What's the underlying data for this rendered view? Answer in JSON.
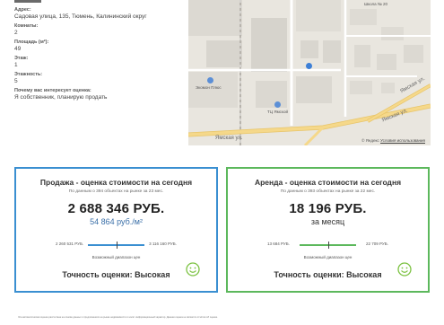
{
  "info": {
    "fields": [
      {
        "label": "Адрес:",
        "value": "Садовая улица, 135, Тюмень, Калининский округ"
      },
      {
        "label": "Комнаты:",
        "value": "2"
      },
      {
        "label": "Площадь (м²):",
        "value": "49"
      },
      {
        "label": "Этаж:",
        "value": "1"
      },
      {
        "label": "Этажность:",
        "value": "5"
      },
      {
        "label": "Почему вас интересует оценка:",
        "value": "Я собственник, планирую продать"
      }
    ]
  },
  "map": {
    "streets": [
      "Ямская ул.",
      "Ямская ул.",
      "Ямская ул."
    ],
    "pois": [
      "Экомон Плюс",
      "ТЦ Ямской",
      "Школа № 20"
    ],
    "copyright": "© Яндекс",
    "terms_link": "Условия использования"
  },
  "sale": {
    "title": "Продажа - оценка стоимости на сегодня",
    "subtitle": "По данным о 394 объектах на рынке за 23 мес.",
    "price": "2 688 346 РУБ.",
    "per_m2": "54 864 руб./м²",
    "range_low": "2 260 531 РУБ.",
    "range_high": "3 116 160 РУБ.",
    "range_caption": "Возможный диапазон цен",
    "accuracy": "Точность оценки: Высокая",
    "marker_position": 0.5,
    "color": "#3a8fd1"
  },
  "rent": {
    "title": "Аренда - оценка стоимости на сегодня",
    "subtitle": "По данным о 393 объектах на рынке за 22 мес.",
    "price": "18 196 РУБ.",
    "period": "за месяц",
    "range_low": "13 684 РУБ.",
    "range_high": "22 709 РУБ.",
    "range_caption": "Возможный диапазон цен",
    "accuracy": "Точность оценки: Высокая",
    "marker_position": 0.5,
    "color": "#5cb85c"
  },
  "footer": {
    "text": "Эта автоматическая оценка рассчитана на основе данных о предложениях на рынке недвижимости и носит информационный характер. Данная оценка не является отчётом об оценке."
  },
  "colors": {
    "map_bg": "#e9e6df",
    "road_yellow": "#f5d88a",
    "poi_blue": "#3d7fd6",
    "smiley_green": "#7cc242"
  },
  "icons": [
    "map-pin-icon",
    "smiley-icon"
  ]
}
